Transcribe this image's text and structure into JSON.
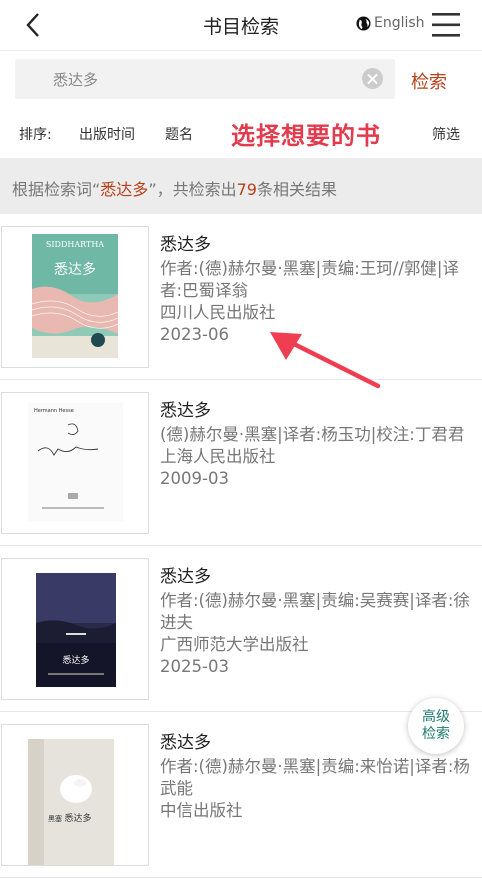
{
  "header": {
    "title": "书目检索",
    "language": "English"
  },
  "search": {
    "query": "悉达多",
    "button": "检索"
  },
  "sort": {
    "label": "排序:",
    "by_date": "出版时间",
    "by_title": "题名",
    "filter": "筛选",
    "overlay_note": "选择想要的书"
  },
  "results": {
    "prefix": "根据检索词“",
    "term": "悉达多",
    "middle": "”，共检索出",
    "count": "79",
    "suffix": "条相关结果"
  },
  "books": [
    {
      "title": "悉达多",
      "lines": [
        "作者:(德)赫尔曼·黑塞|责编:王珂//郭健|译者:巴蜀译翁",
        "四川人民出版社",
        "2023-06"
      ],
      "cover_text": "悉达多",
      "cover_top": "SIDDHARTHA"
    },
    {
      "title": "悉达多",
      "lines": [
        "(德)赫尔曼·黑塞|译者:杨玉功|校注:丁君君",
        "上海人民出版社",
        "2009-03"
      ],
      "cover_text": "Hermann Hesse"
    },
    {
      "title": "悉达多",
      "lines": [
        "作者:(德)赫尔曼·黑塞|责编:吴赛赛|译者:徐进夫",
        "广西师范大学出版社",
        "2025-03"
      ],
      "cover_text": "悉达多"
    },
    {
      "title": "悉达多",
      "lines": [
        "作者:(德)赫尔曼·黑塞|责编:来怡诺|译者:杨武能",
        "中信出版社"
      ],
      "cover_text": "悉达多",
      "cover_top": "黑塞"
    }
  ],
  "fab": {
    "line1": "高级",
    "line2": "检索"
  }
}
